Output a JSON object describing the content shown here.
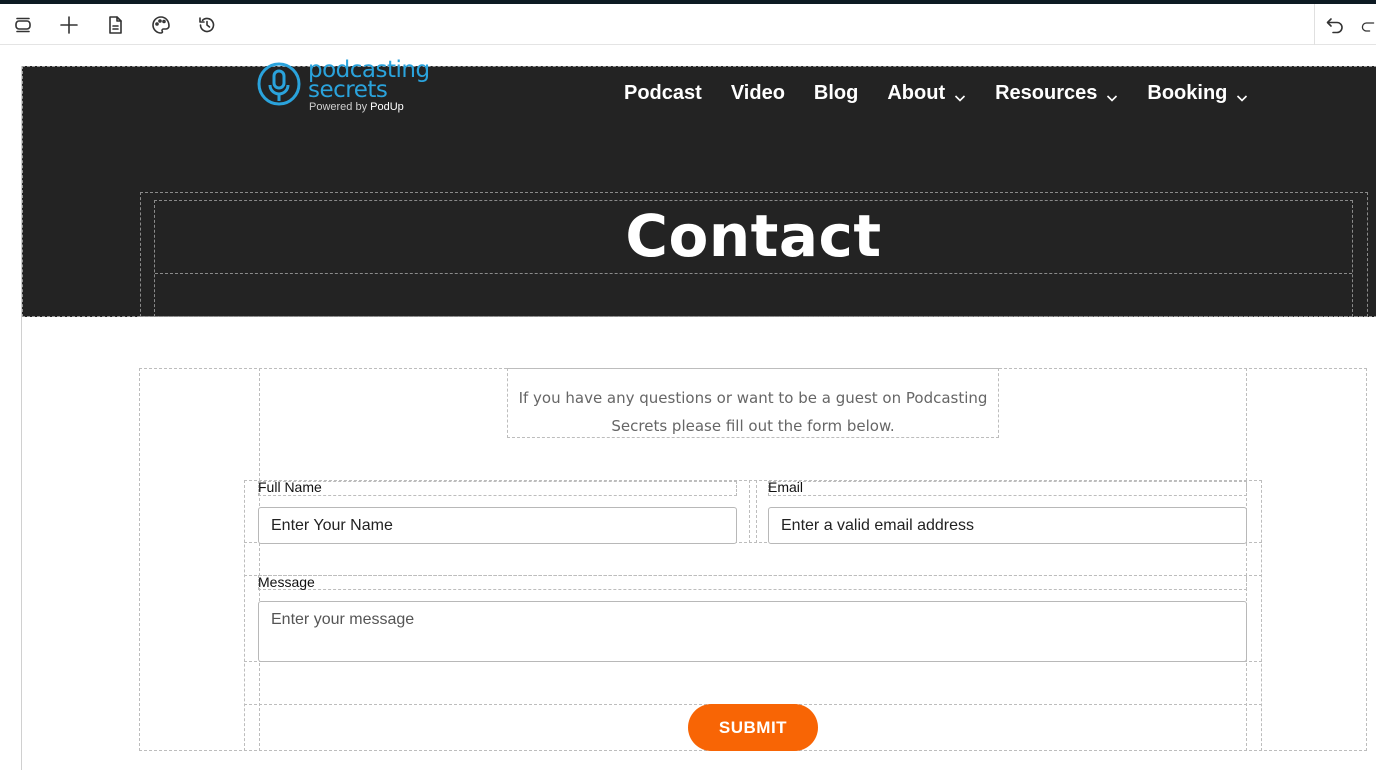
{
  "toolbar": {
    "icons": [
      "layers-icon",
      "add-icon",
      "page-icon",
      "palette-icon",
      "history-icon",
      "undo-icon",
      "redo-icon"
    ]
  },
  "site": {
    "logo": {
      "line1": "podcasting",
      "line2": "secrets",
      "tagline_prefix": "Powered by ",
      "tagline_brand": "PodUp",
      "color": "#2aa3dc"
    },
    "nav": [
      {
        "label": "Podcast",
        "dropdown": false
      },
      {
        "label": "Video",
        "dropdown": false
      },
      {
        "label": "Blog",
        "dropdown": false
      },
      {
        "label": "About",
        "dropdown": true
      },
      {
        "label": "Resources",
        "dropdown": true
      },
      {
        "label": "Booking",
        "dropdown": true
      }
    ],
    "hero_title": "Contact",
    "hero_bg": "#232323"
  },
  "contact": {
    "intro": "If you have any questions or want to be a guest on Podcasting Secrets please fill out the form below.",
    "fields": {
      "name_label": "Full Name",
      "name_placeholder": "Enter Your Name",
      "email_label": "Email",
      "email_placeholder": "Enter a valid email address",
      "message_label": "Message",
      "message_placeholder": "Enter your message"
    },
    "submit_label": "SUBMIT",
    "submit_color": "#f86505"
  }
}
